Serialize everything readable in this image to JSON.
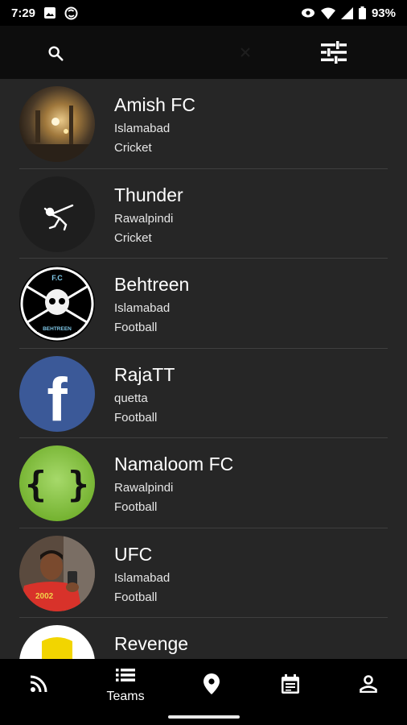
{
  "status_bar": {
    "time": "7:29",
    "battery": "93%",
    "icons": [
      "image-icon",
      "sync-icon",
      "eye-icon",
      "wifi-icon",
      "signal-icon",
      "battery-icon"
    ]
  },
  "top_bar": {
    "search_icon": "search-icon",
    "clear_icon": "close-icon",
    "filter_icon": "tune-icon"
  },
  "teams": [
    {
      "name": "Amish FC",
      "city": "Islamabad",
      "sport": "Cricket",
      "avatar": "night-street-photo"
    },
    {
      "name": "Thunder",
      "city": "Rawalpindi",
      "sport": "Cricket",
      "avatar": "skeleton-dab-logo"
    },
    {
      "name": "Behtreen",
      "city": "Islamabad",
      "sport": "Football",
      "avatar": "skull-fc-badge",
      "avatar_text": {
        "top": "F.C",
        "bottom": "BEHTREEN"
      }
    },
    {
      "name": "RajaTT",
      "city": "quetta",
      "sport": "Football",
      "avatar": "facebook-logo",
      "avatar_text": {
        "glyph": "f"
      }
    },
    {
      "name": "Namaloom FC",
      "city": "Rawalpindi",
      "sport": "Football",
      "avatar": "braces-logo",
      "avatar_text": {
        "glyph": "{ }"
      }
    },
    {
      "name": "UFC",
      "city": "Islamabad",
      "sport": "Football",
      "avatar": "selfie-photo",
      "avatar_text": {
        "shirt": "2002"
      }
    },
    {
      "name": "Revenge",
      "city": "",
      "sport": "",
      "avatar": "yellow-logo"
    }
  ],
  "bottom_nav": {
    "items": [
      {
        "icon": "rss-feed-icon",
        "label": ""
      },
      {
        "icon": "list-icon",
        "label": "Teams"
      },
      {
        "icon": "location-pin-icon",
        "label": ""
      },
      {
        "icon": "calendar-icon",
        "label": ""
      },
      {
        "icon": "person-icon",
        "label": ""
      }
    ],
    "active": "Teams"
  },
  "colors": {
    "background": "#262626",
    "bar": "#000000",
    "divider": "#3f3f3f",
    "facebook_blue": "#3b5998",
    "lime": "#8cc63f"
  }
}
